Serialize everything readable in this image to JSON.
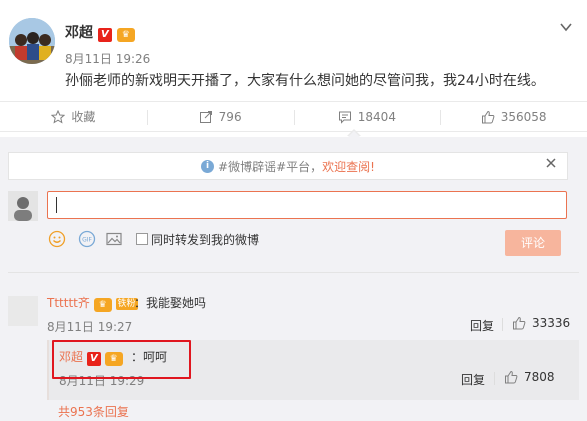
{
  "post": {
    "author": "邓超",
    "v_badge": "V",
    "time": "8月11日 19:26",
    "text": "孙俪老师的新戏明天开播了，大家有什么想问她的尽管问我，我24小时在线。"
  },
  "actions": {
    "collect": "收藏",
    "repost": "796",
    "comment": "18404",
    "like": "356058"
  },
  "notice": {
    "prefix": "#微博辟谣#平台，",
    "highlight": "欢迎查阅!"
  },
  "composer": {
    "sync_label": "同时转发到我的微博",
    "submit_label": "评论"
  },
  "comment": {
    "author": "Tttttt齐",
    "fan_badge": "铁粉",
    "text": "：我能娶她吗",
    "time": "8月11日 19:27",
    "reply_label": "回复",
    "likes": "33336"
  },
  "reply": {
    "author": "邓超",
    "v_badge": "V",
    "text": "：呵呵",
    "time": "8月11日 19:29",
    "reply_label": "回复",
    "likes": "7808",
    "more_label": "共953条回复"
  },
  "colors": {
    "accent": "#eb7350",
    "highlight_box": "#e0161f",
    "panel_bg": "#f2f2f5"
  }
}
